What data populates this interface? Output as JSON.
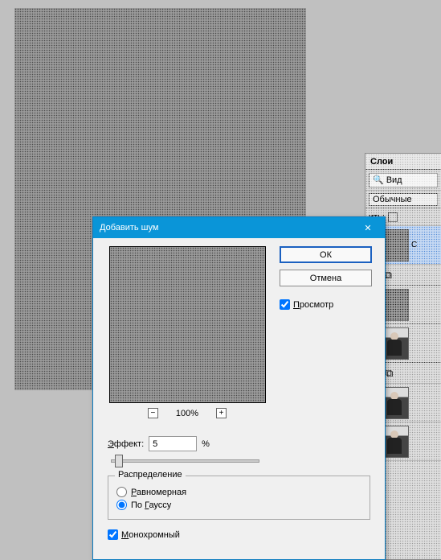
{
  "canvas": {
    "alt": "noise-filled-canvas"
  },
  "dialog": {
    "title": "Добавить шум",
    "close": "✕",
    "ok": "ОК",
    "cancel": "Отмена",
    "preview_checkbox": "Просмотр",
    "zoom_minus": "−",
    "zoom_plus": "+",
    "zoom_pct": "100%",
    "effect_label": "Эффект:",
    "effect_value": "5",
    "effect_unit": "%",
    "distribution_legend": "Распределение",
    "radio_uniform": "Равномерная",
    "radio_gaussian": "По Гауссу",
    "monochrome": "Монохромный",
    "selected_distribution": "gaussian",
    "preview_checked": true,
    "monochrome_checked": true
  },
  "layers_panel": {
    "tab": "Слои",
    "search_label": "Вид",
    "blend_mode": "Обычные",
    "lock_label": "ить:",
    "items": [
      {
        "type": "layer",
        "selected": true,
        "thumb": "noise",
        "label": "С"
      },
      {
        "type": "fx",
        "icons": "link-scale"
      },
      {
        "type": "layer",
        "selected": false,
        "thumb": "noise",
        "label": ""
      },
      {
        "type": "layer",
        "selected": false,
        "thumb": "portrait",
        "label": ""
      },
      {
        "type": "fx",
        "icons": "levels"
      },
      {
        "type": "layer",
        "selected": false,
        "thumb": "portrait",
        "label": ""
      },
      {
        "type": "layer",
        "selected": false,
        "thumb": "portrait",
        "label": ""
      }
    ]
  },
  "icons": {
    "search": "🔍",
    "eye": "👁",
    "link": "⧉",
    "scale": "⚖",
    "levels": "ılıl",
    "chevron": "▾",
    "lock": "🔒"
  }
}
